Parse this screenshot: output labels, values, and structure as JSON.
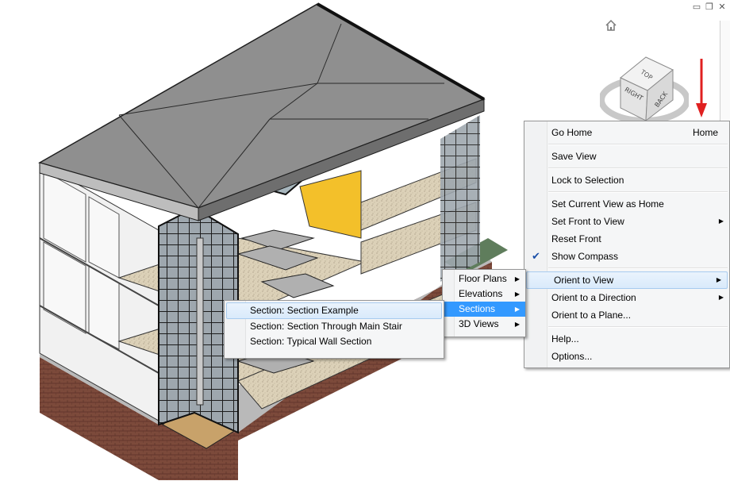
{
  "window_controls": {
    "minimize": "▭",
    "restore": "❐",
    "close": "✕"
  },
  "icons": {
    "home": "home-icon",
    "viewcube": "viewcube-icon",
    "arrow": "red-arrow-indicator"
  },
  "viewcube": {
    "top": "TOP",
    "right": "RIGHT",
    "back": "BACK"
  },
  "main_menu": {
    "items": [
      {
        "label": "Go Home",
        "shortcut": "Home"
      },
      {
        "label": "Save View"
      },
      {
        "label": "Lock to Selection"
      },
      {
        "label": "Set Current View as Home"
      },
      {
        "label": "Set Front to View"
      },
      {
        "label": "Reset Front"
      },
      {
        "label": "Show Compass",
        "checked": true
      },
      {
        "label": "Orient to View"
      },
      {
        "label": "Orient to a Direction"
      },
      {
        "label": "Orient to a Plane..."
      },
      {
        "label": "Help..."
      },
      {
        "label": "Options..."
      }
    ]
  },
  "views_menu": {
    "items": [
      {
        "label": "Floor Plans"
      },
      {
        "label": "Elevations"
      },
      {
        "label": "Sections"
      },
      {
        "label": "3D Views"
      }
    ]
  },
  "sections_menu": {
    "items": [
      {
        "label": "Section: Section Example"
      },
      {
        "label": "Section: Section Through Main Stair"
      },
      {
        "label": "Section: Typical Wall Section"
      }
    ]
  },
  "colors": {
    "accent": "#3399ff",
    "arrow": "#e02020",
    "roof": "#8c8c8c",
    "floor": "#d8cdb6",
    "yellow": "#f5c32a",
    "brick": "#7a4a3a"
  }
}
